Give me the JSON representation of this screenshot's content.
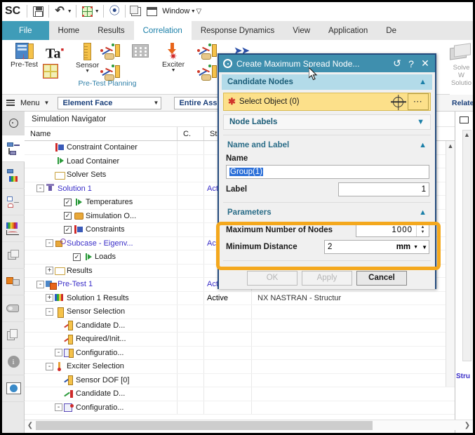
{
  "quick_access": {
    "logo": "SC",
    "items": [
      {
        "name": "save-icon",
        "label": "save"
      },
      {
        "name": "undo-icon",
        "label": "undo"
      },
      {
        "name": "mesh-display-icon",
        "label": "mesh display"
      },
      {
        "name": "paint-icon",
        "label": "paint"
      },
      {
        "name": "duplicate-window-icon",
        "label": "duplicate"
      },
      {
        "name": "window-icon",
        "label": "window"
      }
    ],
    "window_label": "Window",
    "overflow_label": "☰"
  },
  "ribbon": {
    "tabs": [
      {
        "label": "File",
        "state": "file"
      },
      {
        "label": "Home",
        "state": "normal"
      },
      {
        "label": "Results",
        "state": "normal"
      },
      {
        "label": "Correlation",
        "state": "active"
      },
      {
        "label": "Response Dynamics",
        "state": "normal"
      },
      {
        "label": "View",
        "state": "normal"
      },
      {
        "label": "Application",
        "state": "normal"
      },
      {
        "label": "De",
        "state": "normal"
      }
    ],
    "groups": [
      {
        "title": "Pre-Test Planning"
      }
    ],
    "buttons": {
      "pre_test": "Pre-Test",
      "sensor": "Sensor",
      "exciter": "Exciter"
    },
    "right_group_text_line1": "Solve W",
    "right_group_text_line2": "Solutio"
  },
  "selection_bar": {
    "menu_label": "Menu",
    "filter_value": "Element Face",
    "scope_value": "Entire Ass",
    "related_label": "Related "
  },
  "resource_bar": {
    "items": [
      {
        "name": "resource-bar-settings",
        "icon": "gear-icon"
      },
      {
        "name": "resource-bar-simulation-navigator",
        "icon": "simulation-navigator-icon"
      },
      {
        "name": "resource-bar-post-processing-navigator",
        "icon": "post-processing-icon"
      },
      {
        "name": "resource-bar-system-navigator",
        "icon": "system-navigator-icon"
      },
      {
        "name": "resource-bar-xy-function-navigator",
        "icon": "xy-function-icon"
      },
      {
        "name": "resource-bar-part-navigator",
        "icon": "part-navigator-icon"
      },
      {
        "name": "resource-bar-assembly-navigator",
        "icon": "assembly-navigator-icon"
      },
      {
        "name": "resource-bar-constraint-navigator",
        "icon": "constraint-navigator-icon"
      },
      {
        "name": "resource-bar-history-icon",
        "icon": "history-icon"
      },
      {
        "name": "resource-bar-info-icon",
        "icon": "info-icon"
      },
      {
        "name": "resource-bar-web-browser",
        "icon": "web-browser-icon"
      }
    ]
  },
  "navigator": {
    "title": "Simulation Navigator",
    "columns": [
      "Name",
      "C.",
      "Status"
    ],
    "rows": [
      {
        "label": "Constraint Container",
        "indent": 2,
        "expander": "",
        "checkbox": "",
        "icon": "i-constraint",
        "status": "",
        "blue": false,
        "extra": ""
      },
      {
        "label": "Load Container",
        "indent": 2,
        "expander": "",
        "checkbox": "",
        "icon": "i-load",
        "status": "",
        "blue": false,
        "extra": ""
      },
      {
        "label": "Solver Sets",
        "indent": 2,
        "expander": "",
        "checkbox": "",
        "icon": "i-folder",
        "status": "",
        "blue": false,
        "extra": ""
      },
      {
        "label": "Solution 1",
        "indent": 1,
        "expander": "-",
        "checkbox": "",
        "icon": "i-sol",
        "status": "Active",
        "blue": true,
        "extra": ""
      },
      {
        "label": "Temperatures",
        "indent": 3,
        "expander": "",
        "checkbox": "✓",
        "icon": "i-temp",
        "status": "",
        "blue": false,
        "extra": ""
      },
      {
        "label": "Simulation O...",
        "indent": 3,
        "expander": "",
        "checkbox": "✓",
        "icon": "i-simobj",
        "status": "",
        "blue": false,
        "extra": ""
      },
      {
        "label": "Constraints",
        "indent": 3,
        "expander": "",
        "checkbox": "✓",
        "icon": "i-constraint",
        "status": "",
        "blue": false,
        "extra": ""
      },
      {
        "label": "Subcase - Eigenv...",
        "indent": 2,
        "expander": "-",
        "checkbox": "",
        "icon": "i-sub",
        "status": "Active",
        "blue": true,
        "extra": ""
      },
      {
        "label": "Loads",
        "indent": 4,
        "expander": "",
        "checkbox": "✓",
        "icon": "i-load",
        "status": "",
        "blue": false,
        "extra": ""
      },
      {
        "label": "Results",
        "indent": 2,
        "expander": "+",
        "checkbox": "",
        "icon": "i-folder",
        "status": "",
        "blue": false,
        "extra": ""
      },
      {
        "label": "Pre-Test 1",
        "indent": 1,
        "expander": "-",
        "checkbox": "",
        "icon": "i-pretest",
        "status": "Active",
        "blue": true,
        "extra": ""
      },
      {
        "label": "Solution 1 Results",
        "indent": 2,
        "expander": "+",
        "checkbox": "",
        "icon": "i-res",
        "status": "Active",
        "blue": false,
        "extra": "NX NASTRAN - Structur"
      },
      {
        "label": "Sensor Selection",
        "indent": 2,
        "expander": "-",
        "checkbox": "",
        "icon": "i-sensel",
        "status": "",
        "blue": false,
        "extra": ""
      },
      {
        "label": "Candidate D...",
        "indent": 3,
        "expander": "",
        "checkbox": "",
        "icon": "i-cand",
        "status": "",
        "blue": false,
        "extra": ""
      },
      {
        "label": "Required/Init...",
        "indent": 3,
        "expander": "",
        "checkbox": "",
        "icon": "i-cand",
        "status": "",
        "blue": false,
        "extra": ""
      },
      {
        "label": "Configuratio...",
        "indent": 3,
        "expander": "-",
        "checkbox": "",
        "icon": "i-config",
        "status": "",
        "blue": false,
        "extra": ""
      },
      {
        "label": "Exciter Selection",
        "indent": 2,
        "expander": "-",
        "checkbox": "",
        "icon": "i-excsel",
        "status": "",
        "blue": false,
        "extra": ""
      },
      {
        "label": "Sensor DOF [0]",
        "indent": 3,
        "expander": "",
        "checkbox": "",
        "icon": "i-dof",
        "status": "",
        "blue": false,
        "extra": ""
      },
      {
        "label": "Candidate D...",
        "indent": 3,
        "expander": "",
        "checkbox": "",
        "icon": "i-candx",
        "status": "",
        "blue": false,
        "extra": ""
      },
      {
        "label": "Configuratio...",
        "indent": 3,
        "expander": "-",
        "checkbox": "",
        "icon": "i-configx",
        "status": "",
        "blue": false,
        "extra": ""
      }
    ]
  },
  "right_panel": {
    "label_partial": "Stru"
  },
  "dialog": {
    "title": "Create Maximum Spread Node...",
    "title_icons": [
      "reset-icon",
      "help-icon",
      "close-icon"
    ],
    "reset_glyph": "↺",
    "help_glyph": "?",
    "close_glyph": "✕",
    "sections": {
      "candidate_nodes": {
        "header": "Candidate Nodes",
        "select_object_label": "Select Object (0)",
        "node_labels": "Node Labels"
      },
      "name_and_label": {
        "header": "Name and Label",
        "name_label": "Name",
        "name_value": "Group(1)",
        "label_label": "Label",
        "label_value": "1"
      },
      "parameters": {
        "header": "Parameters",
        "max_nodes_label": "Maximum Number of Nodes",
        "max_nodes_value": "1000",
        "min_distance_label": "Minimum Distance",
        "min_distance_value": "2",
        "min_distance_unit": "mm"
      }
    },
    "buttons": [
      {
        "label": "OK",
        "enabled": false
      },
      {
        "label": "Apply",
        "enabled": false
      },
      {
        "label": "Cancel",
        "enabled": true
      }
    ]
  },
  "annotation": {
    "color": "#f4a81d",
    "target": "parameters-section"
  },
  "colors": {
    "dialog_title_bg": "#3f8fae",
    "dialog_border": "#234a7d",
    "section_header_bg": "#b3dbe9",
    "highlight_yellow": "#fce08a",
    "tab_active_text": "#1a7fa8",
    "file_tab_bg": "#3f9cb8",
    "tree_blue": "#3a2ec8",
    "annotation_orange": "#f4a81d"
  }
}
